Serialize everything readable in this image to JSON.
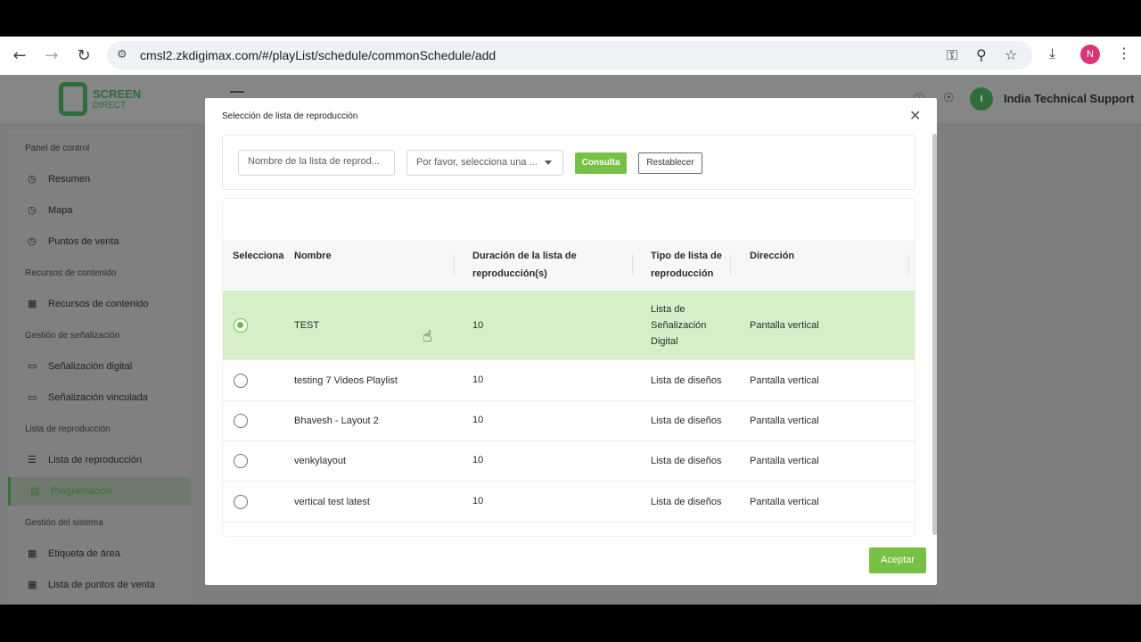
{
  "browser": {
    "url": "cmsl2.zkdigimax.com/#/playList/schedule/commonSchedule/add",
    "profile_initial": "N",
    "icons": [
      "back-icon",
      "forward-icon",
      "reload-icon",
      "site-settings-icon",
      "key-icon",
      "zoom-icon",
      "star-icon",
      "download-icon",
      "menu-dots-icon"
    ]
  },
  "app": {
    "logo_text": "SCREEN",
    "logo_sub": "DIRECT",
    "user_initial": "I",
    "user_name": "India Technical Support",
    "sidebar": {
      "sections": [
        {
          "title": "Panel de control",
          "items": [
            {
              "label": "Resumen",
              "icon": "dashboard-icon"
            },
            {
              "label": "Mapa",
              "icon": "map-icon"
            },
            {
              "label": "Puntos de venta",
              "icon": "store-icon"
            }
          ]
        },
        {
          "title": "Recursos de contenido",
          "items": [
            {
              "label": "Recursos de contenido",
              "icon": "folder-icon"
            }
          ]
        },
        {
          "title": "Gestión de señalización",
          "items": [
            {
              "label": "Señalización digital",
              "icon": "monitor-icon"
            },
            {
              "label": "Señalización vinculada",
              "icon": "linked-monitor-icon"
            }
          ]
        },
        {
          "title": "Lista de reproducción",
          "items": [
            {
              "label": "Lista de reproducción",
              "icon": "playlist-icon"
            },
            {
              "label": "Programación",
              "icon": "schedule-icon",
              "active": true
            }
          ]
        },
        {
          "title": "Gestión del sistema",
          "items": [
            {
              "label": "Etiqueta de área",
              "icon": "tag-icon"
            },
            {
              "label": "Lista de puntos de venta",
              "icon": "list-icon"
            }
          ]
        }
      ]
    }
  },
  "modal": {
    "title": "Selección de lista de reproducción",
    "filters": {
      "name_placeholder": "Nombre de la lista de reprod...",
      "select_placeholder": "Por favor, selecciona una ...",
      "query_label": "Consulta",
      "reset_label": "Restablecer"
    },
    "table": {
      "columns": [
        "Selecciona",
        "Nombre",
        "Duración de la lista de reproducción(s)",
        "Tipo de lista de reproducción",
        "Dirección"
      ],
      "rows": [
        {
          "selected": true,
          "name": "TEST",
          "duration": "10",
          "type": "Lista de Señalización Digital",
          "direction": "Pantalla vertical"
        },
        {
          "selected": false,
          "name": "testing 7 Videos Playlist",
          "duration": "10",
          "type": "Lista de diseños",
          "direction": "Pantalla vertical"
        },
        {
          "selected": false,
          "name": "Bhavesh - Layout 2",
          "duration": "10",
          "type": "Lista de diseños",
          "direction": "Pantalla vertical"
        },
        {
          "selected": false,
          "name": "venkylayout",
          "duration": "10",
          "type": "Lista de diseños",
          "direction": "Pantalla vertical"
        },
        {
          "selected": false,
          "name": "vertical test latest",
          "duration": "10",
          "type": "Lista de diseños",
          "direction": "Pantalla vertical"
        }
      ]
    },
    "accept_label": "Aceptar"
  },
  "colors": {
    "accent_green": "#76c043",
    "selected_row": "#d6efc9"
  }
}
